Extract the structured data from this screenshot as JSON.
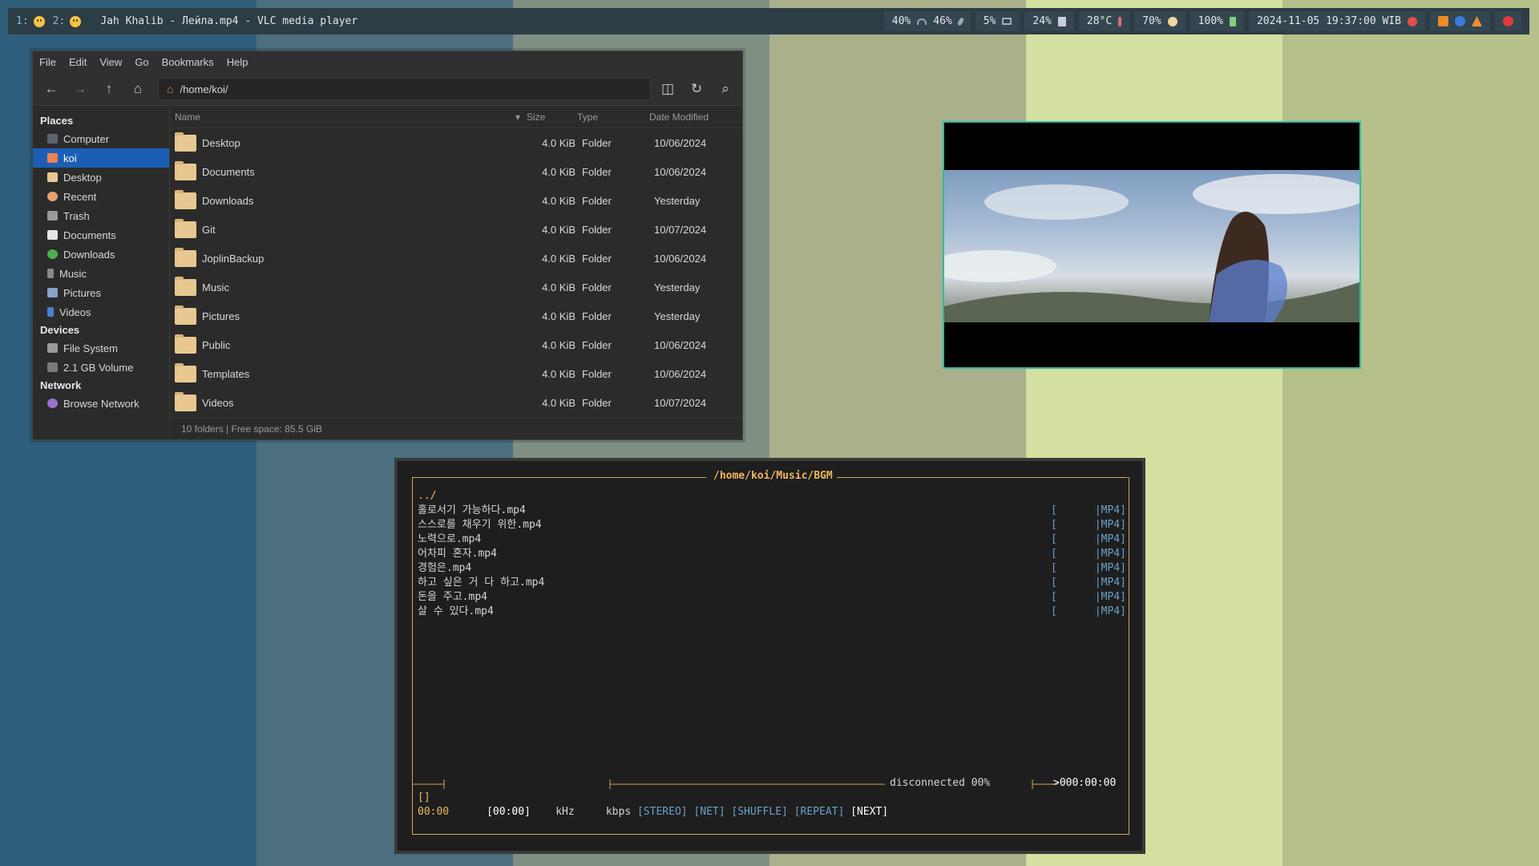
{
  "wallpaper": {
    "colors": [
      "#2f5f7a",
      "#4b6f7c",
      "#7f8f82",
      "#a9b08a",
      "#d4e0a0",
      "#b5c08a"
    ]
  },
  "topbar": {
    "workspaces": [
      {
        "num": "1:",
        "active": true
      },
      {
        "num": "2:",
        "active": false
      }
    ],
    "title": "Jah Khalib - Лейла.mp4 - VLC media player",
    "stats": {
      "volume": "40%",
      "mic": "46%",
      "cpu": "5%",
      "disk": "24%",
      "temp": "28°C",
      "brightness": "70%",
      "battery": "100%"
    },
    "datetime": "2024-11-05 19:37:00 WIB"
  },
  "fm": {
    "menu": [
      "File",
      "Edit",
      "View",
      "Go",
      "Bookmarks",
      "Help"
    ],
    "path": "/home/koi/",
    "sidebar": {
      "places_head": "Places",
      "places": [
        "Computer",
        "koi",
        "Desktop",
        "Recent",
        "Trash",
        "Documents",
        "Downloads",
        "Music",
        "Pictures",
        "Videos"
      ],
      "devices_head": "Devices",
      "devices": [
        "File System",
        "2.1 GB Volume"
      ],
      "network_head": "Network",
      "network": [
        "Browse Network"
      ]
    },
    "columns": {
      "name": "Name",
      "size": "Size",
      "type": "Type",
      "date": "Date Modified"
    },
    "rows": [
      {
        "name": "Desktop",
        "size": "4.0 KiB",
        "type": "Folder",
        "date": "10/06/2024"
      },
      {
        "name": "Documents",
        "size": "4.0 KiB",
        "type": "Folder",
        "date": "10/06/2024"
      },
      {
        "name": "Downloads",
        "size": "4.0 KiB",
        "type": "Folder",
        "date": "Yesterday"
      },
      {
        "name": "Git",
        "size": "4.0 KiB",
        "type": "Folder",
        "date": "10/07/2024"
      },
      {
        "name": "JoplinBackup",
        "size": "4.0 KiB",
        "type": "Folder",
        "date": "10/06/2024"
      },
      {
        "name": "Music",
        "size": "4.0 KiB",
        "type": "Folder",
        "date": "Yesterday"
      },
      {
        "name": "Pictures",
        "size": "4.0 KiB",
        "type": "Folder",
        "date": "Yesterday"
      },
      {
        "name": "Public",
        "size": "4.0 KiB",
        "type": "Folder",
        "date": "10/06/2024"
      },
      {
        "name": "Templates",
        "size": "4.0 KiB",
        "type": "Folder",
        "date": "10/06/2024"
      },
      {
        "name": "Videos",
        "size": "4.0 KiB",
        "type": "Folder",
        "date": "10/07/2024"
      }
    ],
    "status": "10 folders  |  Free space: 85.5 GiB"
  },
  "term": {
    "path": "/home/koi/Music/BGM",
    "up": "../",
    "files": [
      "홀로서기 가능하다.mp4",
      "스스로를 채우기 위한.mp4",
      "노력으로.mp4",
      "어차피 혼자.mp4",
      "경험은.mp4",
      "하고 싶은 거 다 하고.mp4",
      "돈을 주고.mp4",
      "살 수 있다.mp4"
    ],
    "meta": "[      |MP4]",
    "status": "disconnected  00%",
    "time_remaining": ">000:00:00",
    "bars": "[]",
    "time": "00:00",
    "total": "[00:00]",
    "khz": "kHz",
    "kbps": "kbps",
    "flags": [
      "[STEREO]",
      "[NET]",
      "[SHUFFLE]",
      "[REPEAT]"
    ],
    "next": "[NEXT]"
  }
}
